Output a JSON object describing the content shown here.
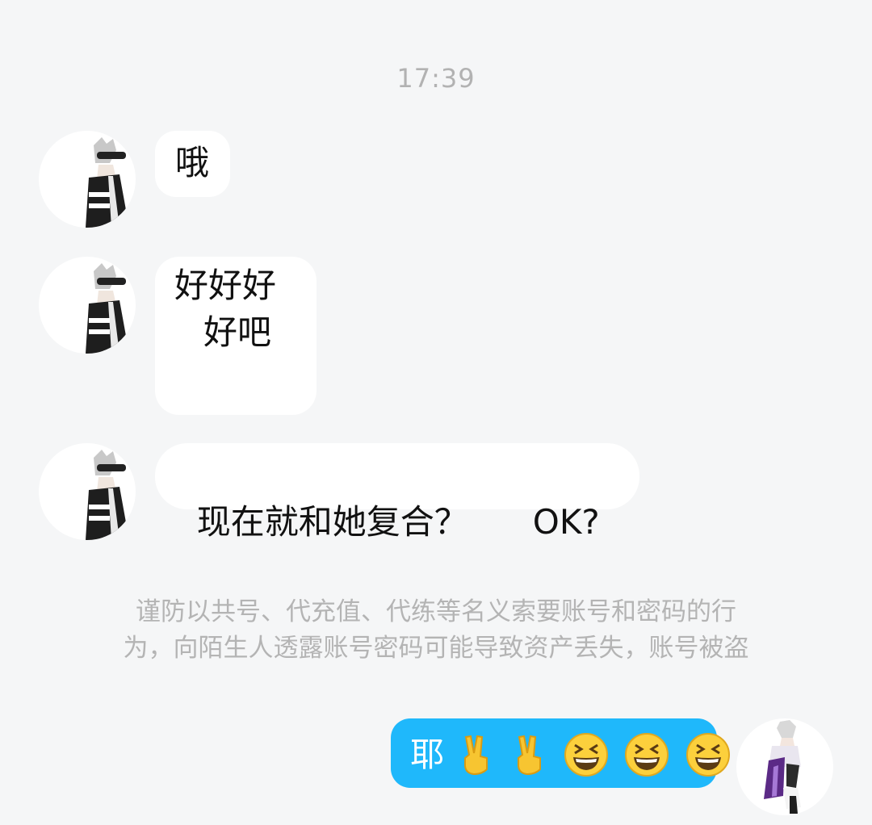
{
  "chat": {
    "timestamp": "17:39",
    "messages": [
      {
        "sender": "friend",
        "text": "哦"
      },
      {
        "sender": "friend",
        "lines": [
          "好好好",
          "好吧"
        ]
      },
      {
        "sender": "friend",
        "text": "现在就和她复合？      OK?"
      }
    ],
    "security_notice": {
      "line1": "谨防以共号、代充值、代练等名义索要账号和密码的行",
      "line2": "为，向陌生人透露账号密码可能导致资产丢失，账号被盗"
    },
    "my_message": {
      "text": "耶",
      "emojis": [
        "victory-hand",
        "victory-hand",
        "grinning-squinting-face",
        "grinning-squinting-face",
        "grinning-squinting-face"
      ]
    }
  },
  "colors": {
    "background": "#f5f6f7",
    "friend_bubble": "#ffffff",
    "my_bubble": "#1fb8fb",
    "timestamp": "#b2b2b2",
    "notice": "#b4b4b4"
  }
}
